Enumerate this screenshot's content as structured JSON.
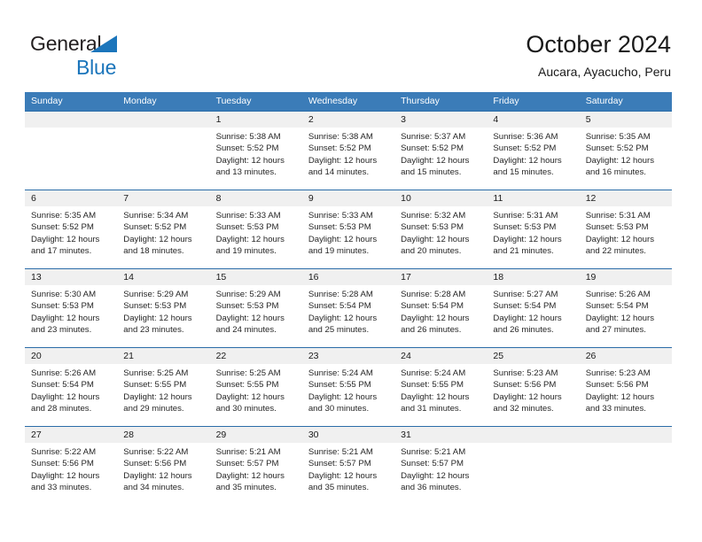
{
  "brand": {
    "line1": "General",
    "line2": "Blue",
    "mark": "triangle-icon",
    "accent_color": "#1b75bb",
    "text_color": "#231f20"
  },
  "header": {
    "title": "October 2024",
    "location": "Aucara, Ayacucho, Peru"
  },
  "calendar": {
    "header_bg": "#3b7cb8",
    "row_divider": "#2b6ca8",
    "daynum_bg": "#f0f0f0",
    "weekdays": [
      "Sunday",
      "Monday",
      "Tuesday",
      "Wednesday",
      "Thursday",
      "Friday",
      "Saturday"
    ],
    "weeks": [
      [
        {
          "day": "",
          "sunrise": "",
          "sunset": "",
          "daylight": "",
          "daylight2": "",
          "empty": true
        },
        {
          "day": "",
          "sunrise": "",
          "sunset": "",
          "daylight": "",
          "daylight2": "",
          "empty": true
        },
        {
          "day": "1",
          "sunrise": "Sunrise: 5:38 AM",
          "sunset": "Sunset: 5:52 PM",
          "daylight": "Daylight: 12 hours",
          "daylight2": "and 13 minutes."
        },
        {
          "day": "2",
          "sunrise": "Sunrise: 5:38 AM",
          "sunset": "Sunset: 5:52 PM",
          "daylight": "Daylight: 12 hours",
          "daylight2": "and 14 minutes."
        },
        {
          "day": "3",
          "sunrise": "Sunrise: 5:37 AM",
          "sunset": "Sunset: 5:52 PM",
          "daylight": "Daylight: 12 hours",
          "daylight2": "and 15 minutes."
        },
        {
          "day": "4",
          "sunrise": "Sunrise: 5:36 AM",
          "sunset": "Sunset: 5:52 PM",
          "daylight": "Daylight: 12 hours",
          "daylight2": "and 15 minutes."
        },
        {
          "day": "5",
          "sunrise": "Sunrise: 5:35 AM",
          "sunset": "Sunset: 5:52 PM",
          "daylight": "Daylight: 12 hours",
          "daylight2": "and 16 minutes."
        }
      ],
      [
        {
          "day": "6",
          "sunrise": "Sunrise: 5:35 AM",
          "sunset": "Sunset: 5:52 PM",
          "daylight": "Daylight: 12 hours",
          "daylight2": "and 17 minutes."
        },
        {
          "day": "7",
          "sunrise": "Sunrise: 5:34 AM",
          "sunset": "Sunset: 5:52 PM",
          "daylight": "Daylight: 12 hours",
          "daylight2": "and 18 minutes."
        },
        {
          "day": "8",
          "sunrise": "Sunrise: 5:33 AM",
          "sunset": "Sunset: 5:53 PM",
          "daylight": "Daylight: 12 hours",
          "daylight2": "and 19 minutes."
        },
        {
          "day": "9",
          "sunrise": "Sunrise: 5:33 AM",
          "sunset": "Sunset: 5:53 PM",
          "daylight": "Daylight: 12 hours",
          "daylight2": "and 19 minutes."
        },
        {
          "day": "10",
          "sunrise": "Sunrise: 5:32 AM",
          "sunset": "Sunset: 5:53 PM",
          "daylight": "Daylight: 12 hours",
          "daylight2": "and 20 minutes."
        },
        {
          "day": "11",
          "sunrise": "Sunrise: 5:31 AM",
          "sunset": "Sunset: 5:53 PM",
          "daylight": "Daylight: 12 hours",
          "daylight2": "and 21 minutes."
        },
        {
          "day": "12",
          "sunrise": "Sunrise: 5:31 AM",
          "sunset": "Sunset: 5:53 PM",
          "daylight": "Daylight: 12 hours",
          "daylight2": "and 22 minutes."
        }
      ],
      [
        {
          "day": "13",
          "sunrise": "Sunrise: 5:30 AM",
          "sunset": "Sunset: 5:53 PM",
          "daylight": "Daylight: 12 hours",
          "daylight2": "and 23 minutes."
        },
        {
          "day": "14",
          "sunrise": "Sunrise: 5:29 AM",
          "sunset": "Sunset: 5:53 PM",
          "daylight": "Daylight: 12 hours",
          "daylight2": "and 23 minutes."
        },
        {
          "day": "15",
          "sunrise": "Sunrise: 5:29 AM",
          "sunset": "Sunset: 5:53 PM",
          "daylight": "Daylight: 12 hours",
          "daylight2": "and 24 minutes."
        },
        {
          "day": "16",
          "sunrise": "Sunrise: 5:28 AM",
          "sunset": "Sunset: 5:54 PM",
          "daylight": "Daylight: 12 hours",
          "daylight2": "and 25 minutes."
        },
        {
          "day": "17",
          "sunrise": "Sunrise: 5:28 AM",
          "sunset": "Sunset: 5:54 PM",
          "daylight": "Daylight: 12 hours",
          "daylight2": "and 26 minutes."
        },
        {
          "day": "18",
          "sunrise": "Sunrise: 5:27 AM",
          "sunset": "Sunset: 5:54 PM",
          "daylight": "Daylight: 12 hours",
          "daylight2": "and 26 minutes."
        },
        {
          "day": "19",
          "sunrise": "Sunrise: 5:26 AM",
          "sunset": "Sunset: 5:54 PM",
          "daylight": "Daylight: 12 hours",
          "daylight2": "and 27 minutes."
        }
      ],
      [
        {
          "day": "20",
          "sunrise": "Sunrise: 5:26 AM",
          "sunset": "Sunset: 5:54 PM",
          "daylight": "Daylight: 12 hours",
          "daylight2": "and 28 minutes."
        },
        {
          "day": "21",
          "sunrise": "Sunrise: 5:25 AM",
          "sunset": "Sunset: 5:55 PM",
          "daylight": "Daylight: 12 hours",
          "daylight2": "and 29 minutes."
        },
        {
          "day": "22",
          "sunrise": "Sunrise: 5:25 AM",
          "sunset": "Sunset: 5:55 PM",
          "daylight": "Daylight: 12 hours",
          "daylight2": "and 30 minutes."
        },
        {
          "day": "23",
          "sunrise": "Sunrise: 5:24 AM",
          "sunset": "Sunset: 5:55 PM",
          "daylight": "Daylight: 12 hours",
          "daylight2": "and 30 minutes."
        },
        {
          "day": "24",
          "sunrise": "Sunrise: 5:24 AM",
          "sunset": "Sunset: 5:55 PM",
          "daylight": "Daylight: 12 hours",
          "daylight2": "and 31 minutes."
        },
        {
          "day": "25",
          "sunrise": "Sunrise: 5:23 AM",
          "sunset": "Sunset: 5:56 PM",
          "daylight": "Daylight: 12 hours",
          "daylight2": "and 32 minutes."
        },
        {
          "day": "26",
          "sunrise": "Sunrise: 5:23 AM",
          "sunset": "Sunset: 5:56 PM",
          "daylight": "Daylight: 12 hours",
          "daylight2": "and 33 minutes."
        }
      ],
      [
        {
          "day": "27",
          "sunrise": "Sunrise: 5:22 AM",
          "sunset": "Sunset: 5:56 PM",
          "daylight": "Daylight: 12 hours",
          "daylight2": "and 33 minutes."
        },
        {
          "day": "28",
          "sunrise": "Sunrise: 5:22 AM",
          "sunset": "Sunset: 5:56 PM",
          "daylight": "Daylight: 12 hours",
          "daylight2": "and 34 minutes."
        },
        {
          "day": "29",
          "sunrise": "Sunrise: 5:21 AM",
          "sunset": "Sunset: 5:57 PM",
          "daylight": "Daylight: 12 hours",
          "daylight2": "and 35 minutes."
        },
        {
          "day": "30",
          "sunrise": "Sunrise: 5:21 AM",
          "sunset": "Sunset: 5:57 PM",
          "daylight": "Daylight: 12 hours",
          "daylight2": "and 35 minutes."
        },
        {
          "day": "31",
          "sunrise": "Sunrise: 5:21 AM",
          "sunset": "Sunset: 5:57 PM",
          "daylight": "Daylight: 12 hours",
          "daylight2": "and 36 minutes."
        },
        {
          "day": "",
          "sunrise": "",
          "sunset": "",
          "daylight": "",
          "daylight2": "",
          "empty": true
        },
        {
          "day": "",
          "sunrise": "",
          "sunset": "",
          "daylight": "",
          "daylight2": "",
          "empty": true
        }
      ]
    ]
  }
}
